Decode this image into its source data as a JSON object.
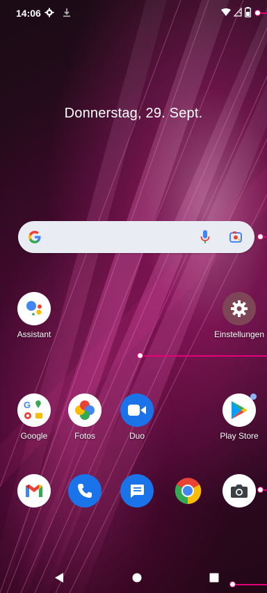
{
  "status_bar": {
    "time": "14:06",
    "icons": [
      "settings-gear-icon",
      "download-icon",
      "wifi-icon",
      "signal-icon",
      "battery-icon"
    ]
  },
  "date_widget": {
    "text": "Donnerstag, 29. Sept."
  },
  "search_bar": {
    "google_logo": "G",
    "icons": [
      "mic-icon",
      "lens-icon"
    ]
  },
  "home_apps": [
    {
      "label": "Assistant",
      "icon": "google-assistant-icon"
    },
    {
      "label": "Einstellungen",
      "icon": "settings-icon"
    }
  ],
  "row_apps": [
    {
      "label": "Google",
      "icon": "google-folder-icon"
    },
    {
      "label": "Fotos",
      "icon": "google-photos-icon"
    },
    {
      "label": "Duo",
      "icon": "duo-camera-icon"
    },
    {
      "label": "Play Store",
      "icon": "play-store-icon"
    }
  ],
  "dock_apps": [
    {
      "icon": "gmail-icon"
    },
    {
      "icon": "phone-icon"
    },
    {
      "icon": "messages-icon"
    },
    {
      "icon": "chrome-icon"
    },
    {
      "icon": "camera-icon"
    }
  ],
  "nav_bar": {
    "icons": [
      "back-icon",
      "home-icon",
      "recents-icon"
    ]
  },
  "colors": {
    "accent": "#e6007a",
    "search_bg": "#e9edf3"
  }
}
